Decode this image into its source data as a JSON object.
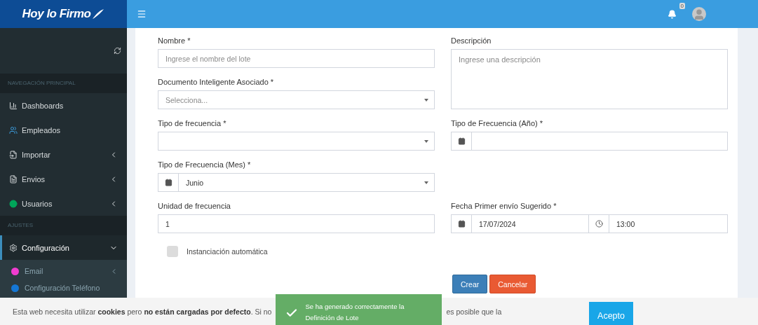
{
  "brand": {
    "name": "Hoy lo Firmo"
  },
  "header": {
    "notification_count": "0"
  },
  "sidebar": {
    "sections": [
      {
        "title": "NAVEGACIÓN PRINCIPAL",
        "items": [
          {
            "label": "Dashboards",
            "kind": "link",
            "selected": false
          },
          {
            "label": "Empleados",
            "kind": "link",
            "selected": false
          },
          {
            "label": "Importar",
            "kind": "menu",
            "expanded": false,
            "selected": false
          },
          {
            "label": "Envios",
            "kind": "menu",
            "expanded": false,
            "selected": false
          },
          {
            "label": "Usuarios",
            "kind": "menu",
            "expanded": false,
            "selected": false
          }
        ]
      },
      {
        "title": "AJUSTES",
        "items": [
          {
            "label": "Configuración",
            "kind": "menu",
            "expanded": true,
            "selected": true,
            "children": [
              {
                "label": "Email",
                "kind": "menu",
                "expanded": false,
                "color": "#f03ccf"
              },
              {
                "label": "Configuración Teléfono",
                "kind": "link",
                "color": "#1577d4"
              }
            ]
          }
        ]
      }
    ]
  },
  "form": {
    "left_column": [
      {
        "label": "Nombre *",
        "kind": "text",
        "placeholder": "Ingrese el nombre del lote"
      },
      {
        "label": "Documento Inteligente Asociado *",
        "kind": "select",
        "placeholder": "Selecciona..."
      },
      {
        "label": "Tipo de frecuencia *",
        "kind": "select"
      },
      {
        "label": "Tipo de Frecuencia (Mes) *",
        "kind": "addon-select",
        "value": "Junio"
      },
      {
        "label": "Unidad de frecuencia",
        "kind": "text",
        "value": "1"
      },
      {
        "label": "Instanciación automática",
        "kind": "checkbox",
        "checked": false
      }
    ],
    "right_column": [
      {
        "label": "Descripción",
        "kind": "textarea",
        "placeholder": "Ingrese una descripción"
      },
      {
        "label": "Tipo de Frecuencia (Año) *",
        "kind": "date"
      },
      {
        "label": "Fecha Primer envío Sugerido *",
        "kind": "datetime",
        "value": "17/07/2024",
        "time": "13:00"
      }
    ],
    "buttons": [
      {
        "label": "Crear",
        "kind": "primary"
      },
      {
        "label": "Cancelar",
        "kind": "danger"
      }
    ]
  },
  "toast": {
    "message": "Se ha generado correctamente la Definición de Lote"
  },
  "cookie_bar": {
    "text_start": "Esta web necesita utilizar **cookies** pero **no están cargadas por defecto**. Si no",
    "text_end": "es posible que la",
    "button": "Acepto"
  }
}
